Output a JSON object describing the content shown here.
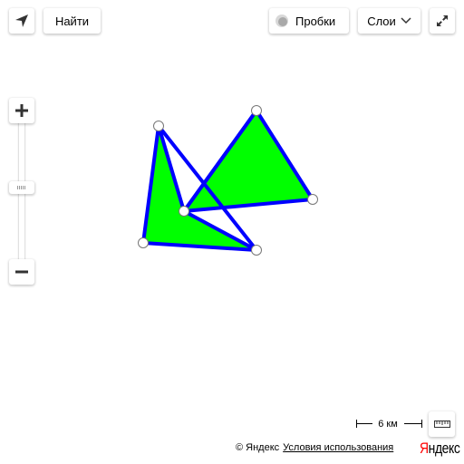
{
  "toolbar": {
    "geolocation_icon": "arrow-cursor-icon",
    "find_label": "Найти",
    "traffic_label": "Пробки",
    "traffic_icon": "traffic-light-icon",
    "layers_label": "Слои",
    "layers_icon": "chevron-down-icon",
    "fullscreen_icon": "expand-icon"
  },
  "zoom": {
    "in_icon": "plus-icon",
    "out_icon": "minus-icon"
  },
  "map": {
    "polygon_fill": "#00ff00",
    "polygon_stroke": "#0000ff"
  },
  "scale": {
    "label": "6 км"
  },
  "ruler": {
    "icon": "ruler-icon"
  },
  "footer": {
    "copyright": "© Яндекс",
    "terms_link": "Условия использования",
    "logo_first": "Я",
    "logo_rest": "ндекс"
  }
}
